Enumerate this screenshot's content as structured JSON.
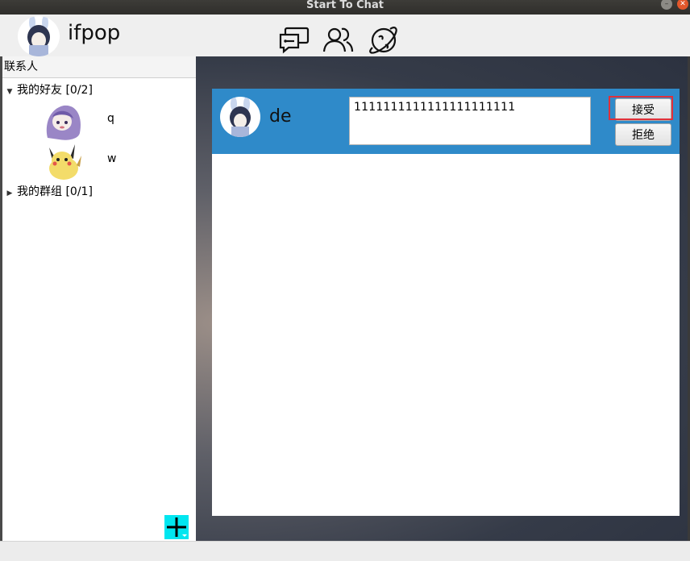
{
  "window": {
    "title": "Start To Chat"
  },
  "header": {
    "username": "ifpop",
    "nav_icons": [
      "chat-bubbles-icon",
      "contacts-icon",
      "planet-icon"
    ]
  },
  "sidebar": {
    "header": "联系人",
    "groups": [
      {
        "label": "我的好友 [0/2]",
        "expanded": true
      },
      {
        "label": "我的群组 [0/1]",
        "expanded": false
      }
    ],
    "friends": [
      {
        "name": "q",
        "avatar": "purple-anime-avatar"
      },
      {
        "name": "w",
        "avatar": "pikachu-avatar"
      }
    ],
    "add_button_icon": "plus-icon"
  },
  "request": {
    "name": "de",
    "message": "1111111111111111111111",
    "accept_label": "接受",
    "reject_label": "拒绝"
  },
  "colors": {
    "card": "#2f8ac9",
    "add_button": "#00e6f0",
    "highlight": "#e0303a"
  }
}
